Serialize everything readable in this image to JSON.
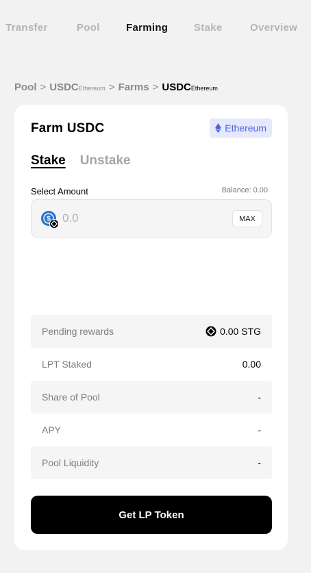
{
  "nav": {
    "items": [
      {
        "label": "Transfer"
      },
      {
        "label": "Pool"
      },
      {
        "label": "Farming"
      },
      {
        "label": "Stake"
      },
      {
        "label": "Overview"
      }
    ],
    "active": "Farming"
  },
  "breadcrumb": {
    "pool": "Pool",
    "asset": "USDC",
    "asset_chain": "Ethereum",
    "farms": "Farms",
    "current": "USDC",
    "current_chain": "Ethereum",
    "separator": ">"
  },
  "card": {
    "title": "Farm USDC",
    "chain_badge": "Ethereum",
    "tabs": {
      "stake": "Stake",
      "unstake": "Unstake"
    },
    "select_label": "Select Amount",
    "balance": "Balance: 0.00",
    "amount_placeholder": "0.0",
    "max_label": "MAX",
    "info": {
      "pending_rewards": {
        "label": "Pending rewards",
        "value": "0.00 STG"
      },
      "lpt_staked": {
        "label": "LPT Staked",
        "value": "0.00"
      },
      "share_of_pool": {
        "label": "Share of Pool",
        "value": "-"
      },
      "apy": {
        "label": "APY",
        "value": "-"
      },
      "pool_liquidity": {
        "label": "Pool Liquidity",
        "value": "-"
      }
    },
    "cta_label": "Get LP Token"
  },
  "colors": {
    "background": "#f2f2f2",
    "card": "#ffffff",
    "accent_blue": "#4a63d9",
    "badge_bg": "#e5e9fb",
    "usdc_blue": "#2775ca",
    "cta": "#000000"
  },
  "icons": {
    "chain": "ethereum-icon",
    "token": "usdc-icon",
    "reward": "stg-icon"
  }
}
